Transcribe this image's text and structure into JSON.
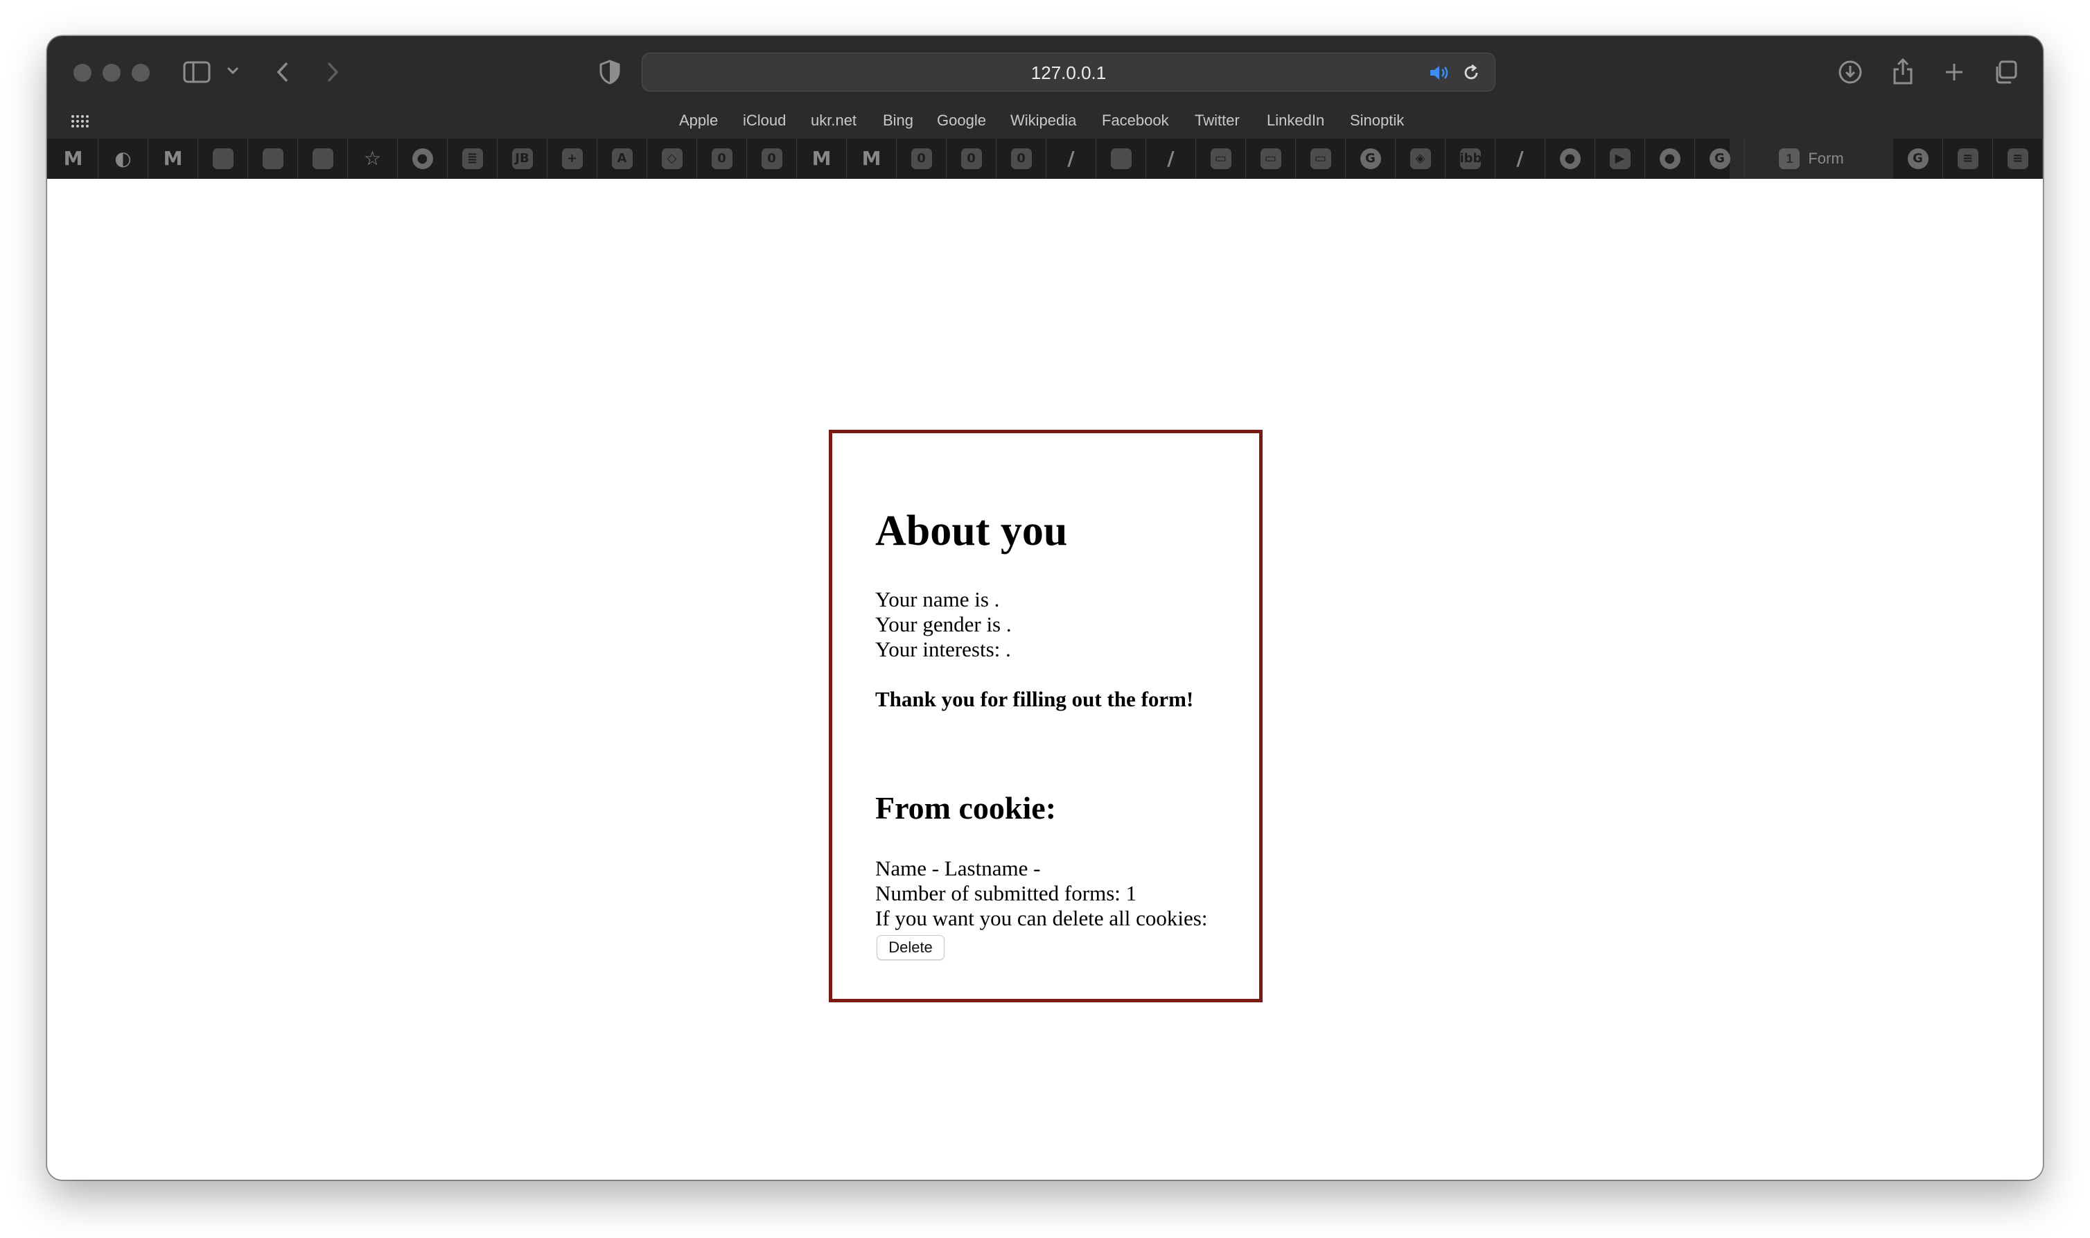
{
  "browser": {
    "url": "127.0.0.1",
    "favorites": [
      "Apple",
      "iCloud",
      "ukr.net",
      "Bing",
      "Google",
      "Wikipedia",
      "Facebook",
      "Twitter",
      "LinkedIn",
      "Sinoptik"
    ],
    "active_tab": {
      "badge": "1",
      "title": "Form"
    },
    "pinned_tabs": [
      {
        "icon": "gmail-icon",
        "glyph": "M"
      },
      {
        "icon": "pacman-icon",
        "glyph": "◐"
      },
      {
        "icon": "gmail-icon",
        "glyph": "M"
      },
      {
        "icon": "app-icon",
        "glyph": ""
      },
      {
        "icon": "app-icon",
        "glyph": ""
      },
      {
        "icon": "app-icon",
        "glyph": ""
      },
      {
        "icon": "star-icon",
        "glyph": "☆"
      },
      {
        "icon": "globe-icon",
        "glyph": "●"
      },
      {
        "icon": "list-icon",
        "glyph": "≣"
      },
      {
        "icon": "jetbrains-icon",
        "glyph": "JB"
      },
      {
        "icon": "plus-tile-icon",
        "glyph": "+"
      },
      {
        "icon": "font-icon",
        "glyph": "A"
      },
      {
        "icon": "code-icon",
        "glyph": "◇"
      },
      {
        "icon": "upwork-icon",
        "glyph": "0"
      },
      {
        "icon": "upwork-icon",
        "glyph": "0"
      },
      {
        "icon": "gmail-icon",
        "glyph": "M"
      },
      {
        "icon": "gmail-icon",
        "glyph": "M"
      },
      {
        "icon": "upwork-icon",
        "glyph": "0"
      },
      {
        "icon": "upwork-icon",
        "glyph": "0"
      },
      {
        "icon": "upwork-icon",
        "glyph": "0"
      },
      {
        "icon": "pen-icon",
        "glyph": "/"
      },
      {
        "icon": "app-icon",
        "glyph": ""
      },
      {
        "icon": "curve-icon",
        "glyph": "/"
      },
      {
        "icon": "tray-icon",
        "glyph": "▭"
      },
      {
        "icon": "person-icon",
        "glyph": "▭"
      },
      {
        "icon": "tray-icon",
        "glyph": "▭"
      },
      {
        "icon": "grammarly-icon",
        "glyph": "G"
      },
      {
        "icon": "diamond-icon",
        "glyph": "◈"
      },
      {
        "icon": "ibb-icon",
        "glyph": "ibb"
      },
      {
        "icon": "curve-icon",
        "glyph": "/"
      },
      {
        "icon": "github-icon",
        "glyph": "●"
      },
      {
        "icon": "youtube-icon",
        "glyph": "▶"
      },
      {
        "icon": "github-icon",
        "glyph": "●"
      },
      {
        "icon": "grammarly-icon",
        "glyph": "G"
      }
    ],
    "trailing_tabs": [
      {
        "icon": "grammarly-icon",
        "glyph": "G"
      },
      {
        "icon": "stackoverflow-icon",
        "glyph": "≡"
      },
      {
        "icon": "stackoverflow-icon",
        "glyph": "≡"
      }
    ]
  },
  "page": {
    "heading": "About you",
    "name_line": "Your name is .",
    "gender_line": "Your gender is .",
    "interests_line": "Your interests: .",
    "thanks": "Thank you for filling out the form!",
    "cookie_heading": "From cookie:",
    "cookie_name_line": "Name - Lastname -",
    "forms_count_line": "Number of submitted forms: 1",
    "delete_prompt": "If you want you can delete all cookies:",
    "delete_button": "Delete"
  },
  "colors": {
    "card_border": "#7a1a12",
    "toolbar": "#2b2b2d"
  }
}
